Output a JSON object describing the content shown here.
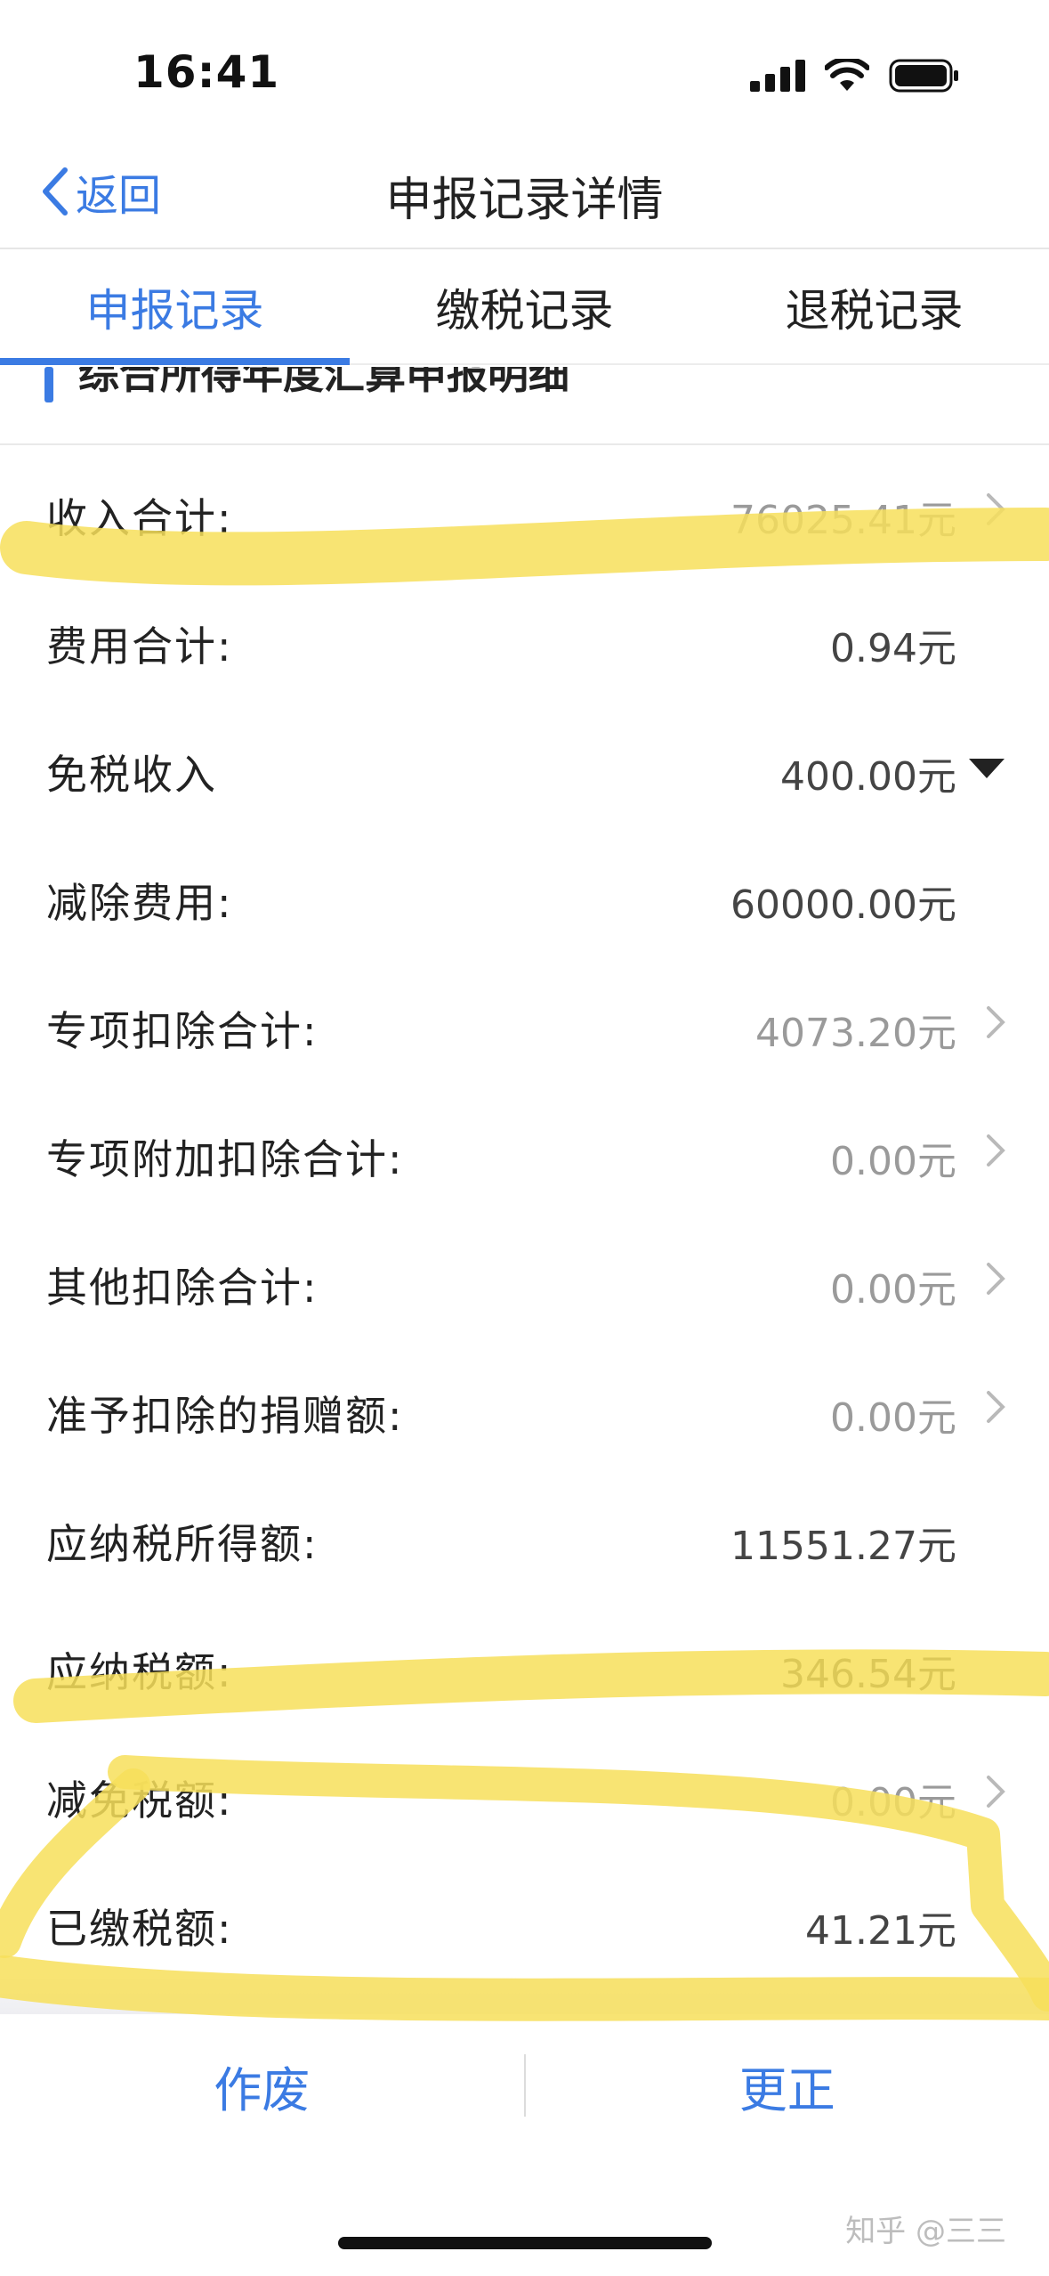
{
  "status_bar": {
    "time": "16:41"
  },
  "nav": {
    "back_label": "返回",
    "title": "申报记录详情"
  },
  "tabs": [
    {
      "label": "申报记录",
      "active": true
    },
    {
      "label": "缴税记录",
      "active": false
    },
    {
      "label": "退税记录",
      "active": false
    }
  ],
  "section": {
    "title": "综合所得年度汇算申报明细"
  },
  "rows": [
    {
      "label": "收入合计:",
      "value": "76025.41元",
      "control": "arrow"
    },
    {
      "label": "费用合计:",
      "value": "0.94元",
      "control": "none"
    },
    {
      "label": "免税收入",
      "value": "400.00元",
      "control": "caret"
    },
    {
      "label": "减除费用:",
      "value": "60000.00元",
      "control": "none"
    },
    {
      "label": "专项扣除合计:",
      "value": "4073.20元",
      "control": "arrow"
    },
    {
      "label": "专项附加扣除合计:",
      "value": "0.00元",
      "control": "arrow"
    },
    {
      "label": "其他扣除合计:",
      "value": "0.00元",
      "control": "arrow"
    },
    {
      "label": "准予扣除的捐赠额:",
      "value": "0.00元",
      "control": "arrow"
    },
    {
      "label": "应纳税所得额:",
      "value": "11551.27元",
      "control": "none"
    },
    {
      "label": "应纳税额:",
      "value": "346.54元",
      "control": "none"
    },
    {
      "label": "减免税额:",
      "value": "0.00元",
      "control": "arrow"
    },
    {
      "label": "已缴税额:",
      "value": "41.21元",
      "control": "none"
    }
  ],
  "actions": {
    "void_label": "作废",
    "correct_label": "更正"
  },
  "watermark": "知乎 @三三",
  "colors": {
    "accent": "#3b7be3",
    "highlighter": "#f7df5a"
  }
}
